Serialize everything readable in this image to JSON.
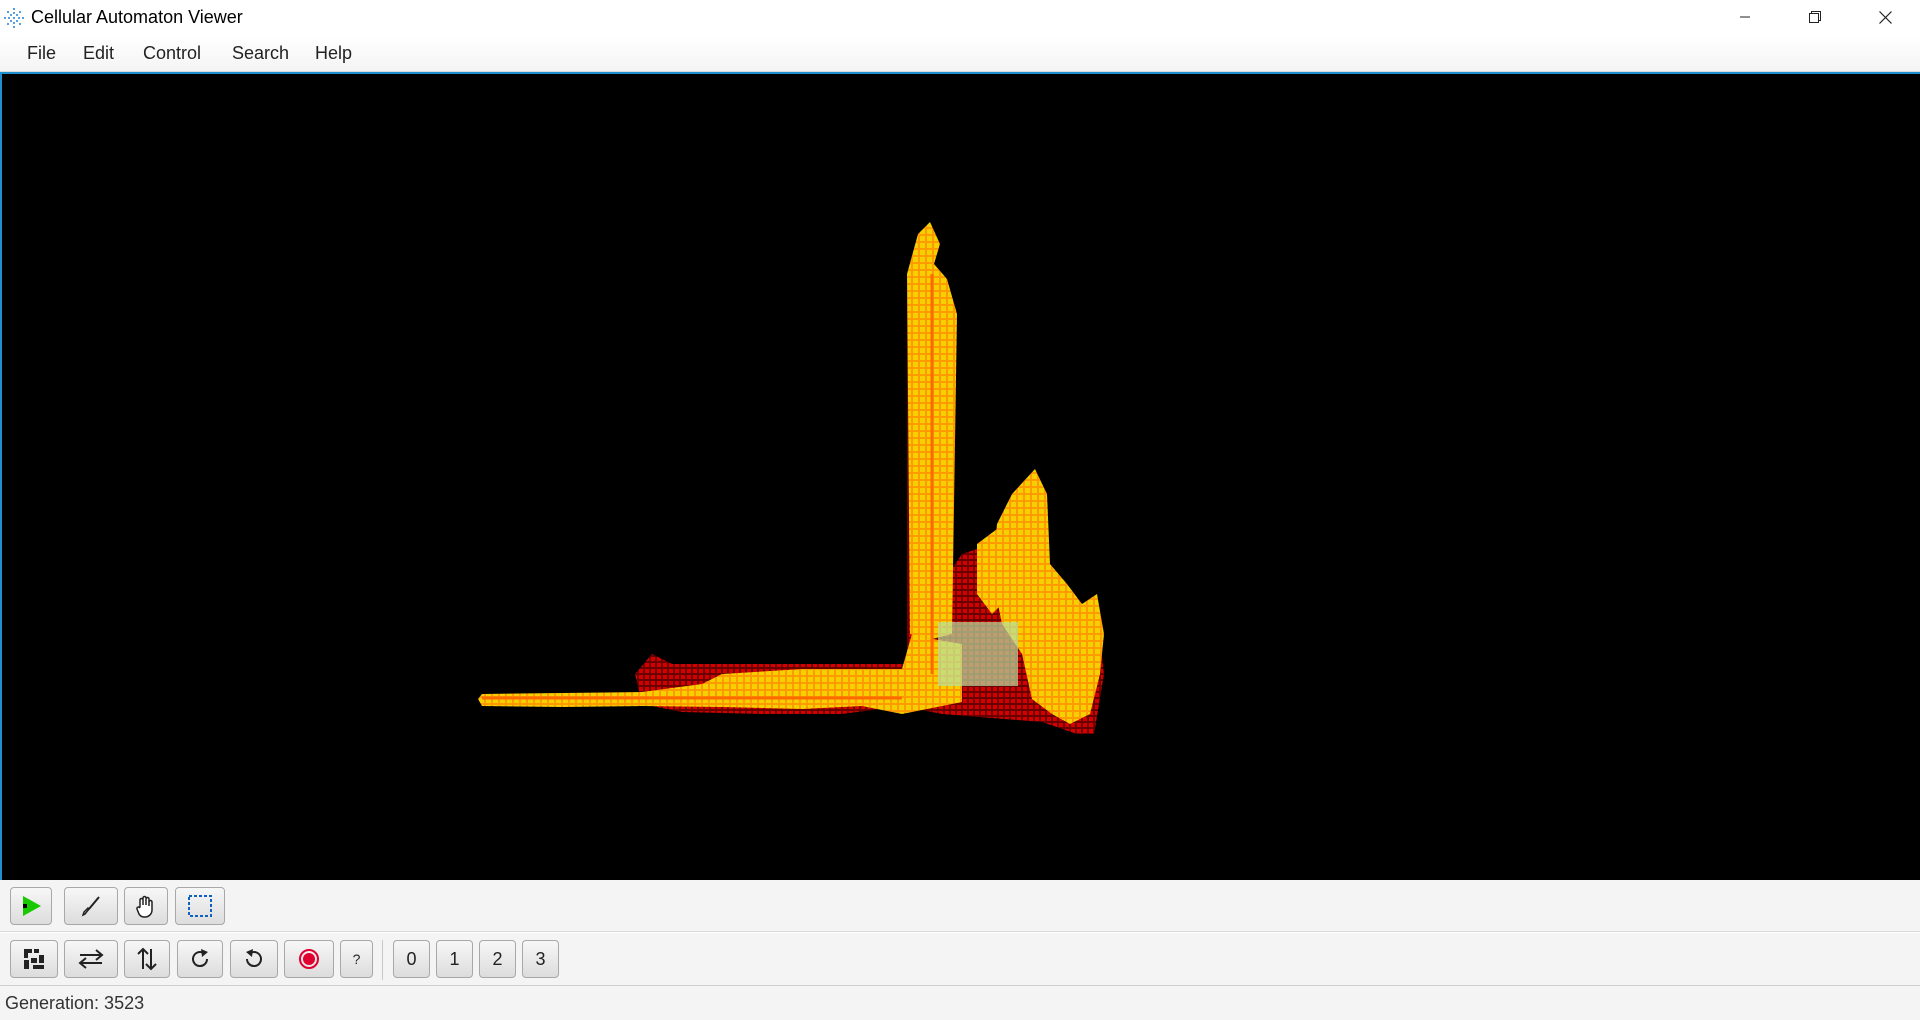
{
  "window": {
    "title": "Cellular Automaton Viewer"
  },
  "menu": {
    "items": [
      "File",
      "Edit",
      "Control",
      "Search",
      "Help"
    ]
  },
  "toolbar_top": {
    "buttons": [
      "play-icon",
      "brush-icon",
      "hand-icon",
      "selection-icon"
    ]
  },
  "toolbar_bottom": {
    "buttons": [
      "fit-pattern-icon",
      "flip-horizontal-icon",
      "flip-vertical-icon",
      "rotate-clockwise-icon",
      "rotate-counterclockwise-icon",
      "record-icon",
      "?"
    ],
    "states": [
      "0",
      "1",
      "2",
      "3"
    ]
  },
  "colors": {
    "cell_live": "#f5d000",
    "cell_dying": "#ff9a00",
    "cell_old": "#c40000",
    "background": "#000000",
    "selection": "#b8e0a0"
  },
  "status": {
    "generation": "Generation: 3523"
  }
}
